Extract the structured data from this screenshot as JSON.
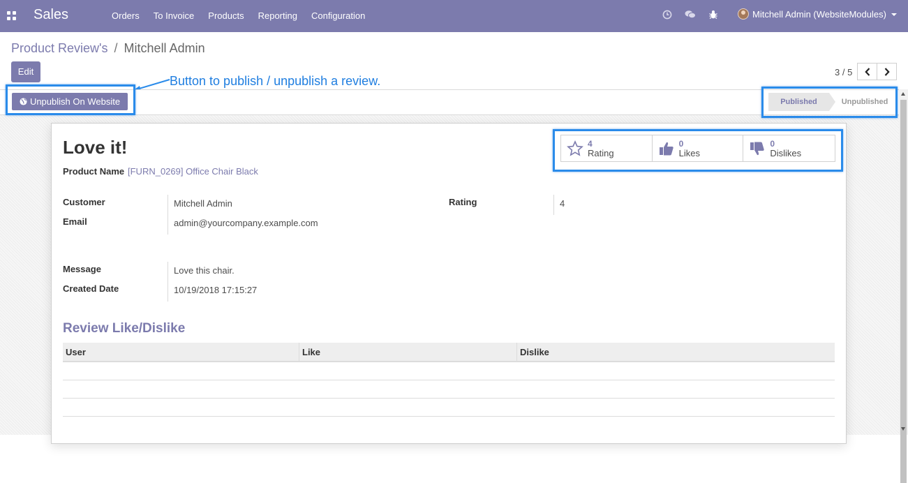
{
  "navbar": {
    "app_name": "Sales",
    "menu": [
      "Orders",
      "To Invoice",
      "Products",
      "Reporting",
      "Configuration"
    ],
    "user": "Mitchell Admin (WebsiteModules)",
    "color": "#7c7bad"
  },
  "breadcrumb": {
    "parent": "Product Review's",
    "separator": "/",
    "current": "Mitchell Admin"
  },
  "toolbar": {
    "edit_label": "Edit"
  },
  "pager": {
    "value": "3 / 5"
  },
  "annotation": {
    "text": "Button to publish / unpublish a review."
  },
  "header": {
    "unpublish_label": "Unpublish On Website",
    "status": {
      "active": "Published",
      "inactive": "Unpublished"
    }
  },
  "stats": {
    "rating": {
      "value": "4",
      "label": "Rating"
    },
    "likes": {
      "value": "0",
      "label": "Likes"
    },
    "dislikes": {
      "value": "0",
      "label": "Dislikes"
    }
  },
  "record": {
    "title": "Love it!",
    "product_label": "Product Name",
    "product_value": "[FURN_0269] Office Chair Black",
    "customer_label": "Customer",
    "customer_value": "Mitchell Admin",
    "email_label": "Email",
    "email_value": "admin@yourcompany.example.com",
    "rating_label": "Rating",
    "rating_value": "4",
    "message_label": "Message",
    "message_value": "Love this chair.",
    "created_label": "Created Date",
    "created_value": "10/19/2018 17:15:27"
  },
  "like_section": {
    "title": "Review Like/Dislike",
    "columns": [
      "User",
      "Like",
      "Dislike"
    ]
  },
  "colors": {
    "primary": "#7c7bad",
    "highlight": "#2a8bea",
    "annotation": "#1f7ee0"
  }
}
